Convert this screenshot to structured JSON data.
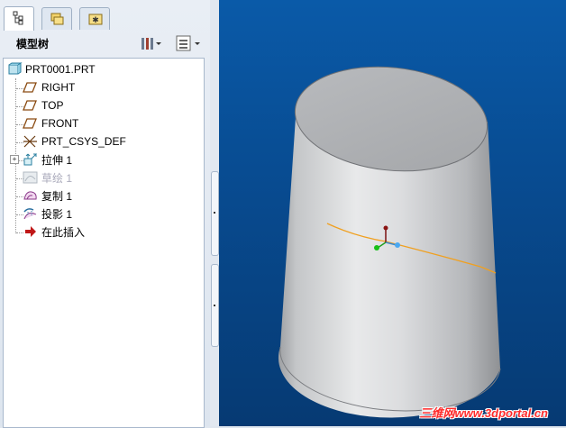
{
  "tabs": [
    {
      "icon": "model-tree-icon"
    },
    {
      "icon": "folder-browser-icon"
    },
    {
      "icon": "favorites-icon"
    }
  ],
  "panel": {
    "title": "模型树",
    "settings_icon": "tree-settings-icon",
    "show_icon": "tree-show-icon"
  },
  "tree": {
    "items": [
      {
        "label": "PRT0001.PRT",
        "icon": "part-icon"
      },
      {
        "label": "RIGHT",
        "icon": "datum-plane-icon"
      },
      {
        "label": "TOP",
        "icon": "datum-plane-icon"
      },
      {
        "label": "FRONT",
        "icon": "datum-plane-icon"
      },
      {
        "label": "PRT_CSYS_DEF",
        "icon": "coordinate-system-icon"
      },
      {
        "label": "拉伸 1",
        "icon": "extrude-icon"
      },
      {
        "label": "草绘 1",
        "icon": "sketch-icon"
      },
      {
        "label": "复制 1",
        "icon": "copy-surface-icon"
      },
      {
        "label": "投影 1",
        "icon": "projection-icon"
      },
      {
        "label": "在此插入",
        "icon": "insert-here-arrow-icon"
      }
    ]
  },
  "viewport": {
    "watermark": "三维网www.3dportal.cn",
    "colors": {
      "background_top": "#0a5aa8",
      "background_bottom": "#063a73",
      "curve": "#f0a020"
    }
  }
}
